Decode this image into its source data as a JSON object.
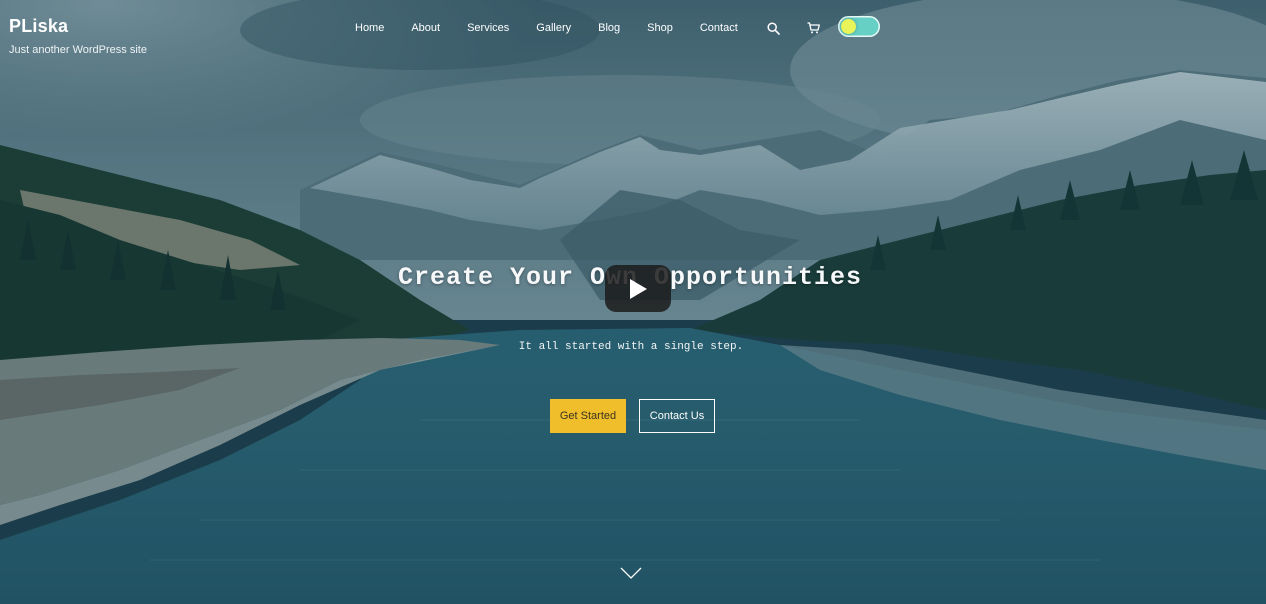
{
  "site": {
    "title": "PLiska",
    "tagline": "Just another WordPress site"
  },
  "nav": {
    "items": [
      {
        "label": "Home"
      },
      {
        "label": "About"
      },
      {
        "label": "Services"
      },
      {
        "label": "Gallery"
      },
      {
        "label": "Blog"
      },
      {
        "label": "Shop"
      },
      {
        "label": "Contact"
      }
    ],
    "icons": [
      "search-icon",
      "cart-icon"
    ],
    "dark_mode_toggle": {
      "state": "off"
    }
  },
  "hero": {
    "title": "Create Your Own Opportunities",
    "subtitle": "It all started with a single step.",
    "primary_button": "Get Started",
    "secondary_button": "Contact Us",
    "play_button_icon": "play-icon",
    "scroll_icon": "chevron-down-icon"
  },
  "colors": {
    "primary_button_bg": "#f0be2b",
    "toggle_bg": "#66d0c5",
    "toggle_knob": "#e8f45a",
    "overlay_tint": "#184252"
  }
}
